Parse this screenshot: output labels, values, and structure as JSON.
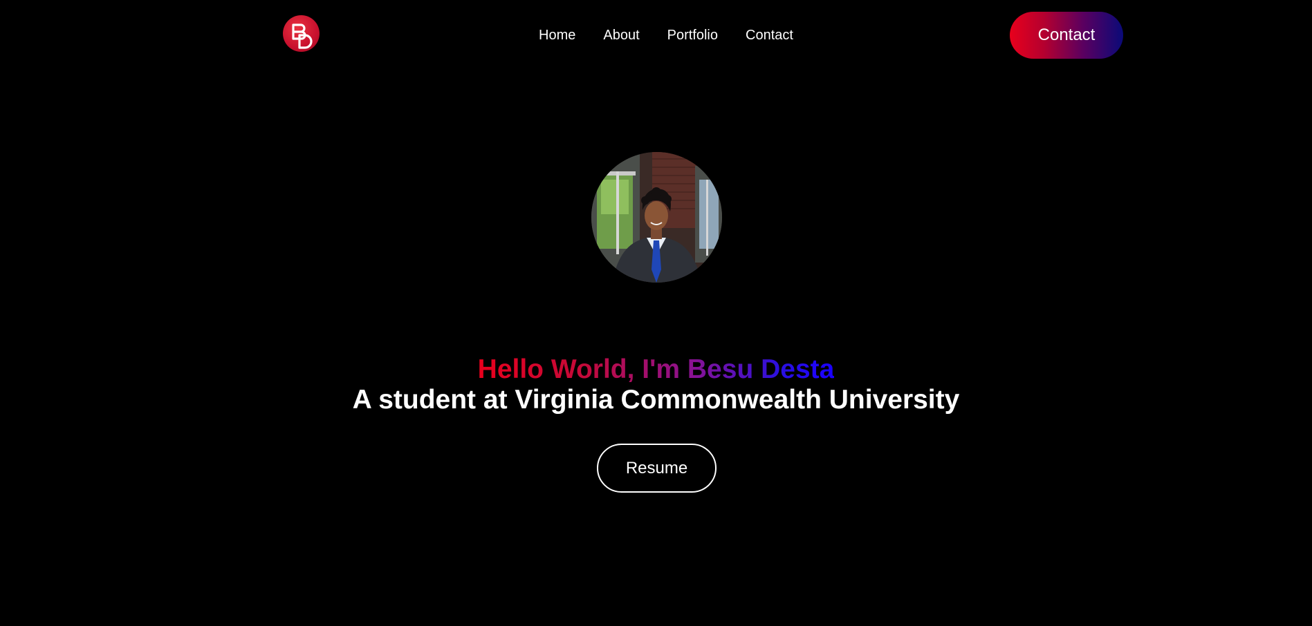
{
  "header": {
    "logo_icon": "bd-monogram-logo-icon",
    "nav": [
      {
        "label": "Home"
      },
      {
        "label": "About"
      },
      {
        "label": "Portfolio"
      },
      {
        "label": "Contact"
      }
    ],
    "cta_label": "Contact"
  },
  "hero": {
    "avatar_icon": "profile-photo",
    "greeting": "Hello World, I'm Besu Desta",
    "subtitle": "A student at Virginia Commonwealth University",
    "resume_label": "Resume"
  },
  "colors": {
    "background": "#000000",
    "text": "#ffffff",
    "accent_red": "#e8001c",
    "accent_purple": "#8a1292",
    "accent_blue": "#1a00ff",
    "logo_red": "#c8102e"
  }
}
